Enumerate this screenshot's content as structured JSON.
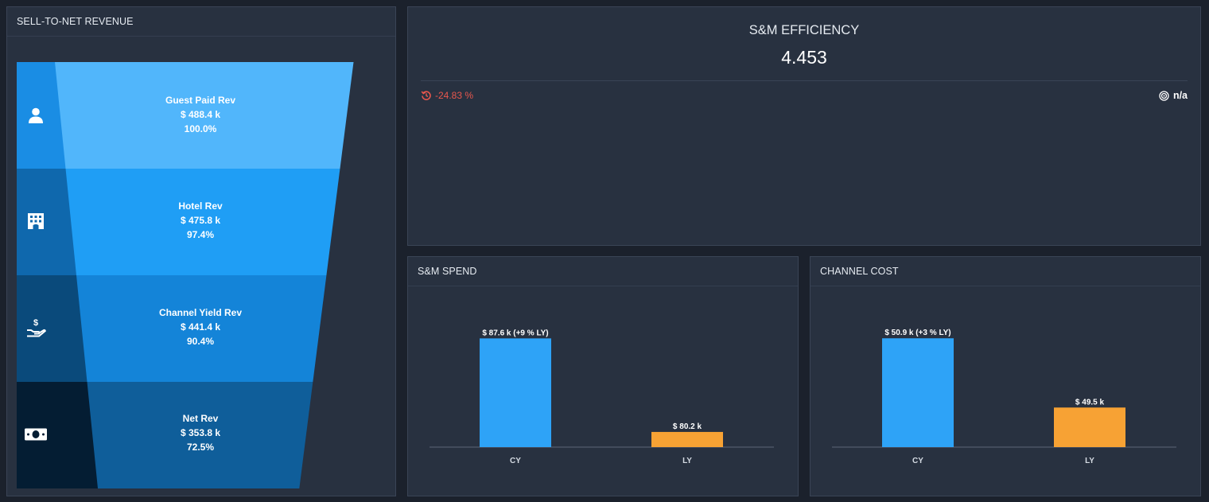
{
  "funnel": {
    "title": "SELL-TO-NET REVENUE",
    "stages": [
      {
        "label": "Guest Paid Rev",
        "value": "$ 488.4 k",
        "pct": "100.0%",
        "ratio": 1.0,
        "icon": "person-icon"
      },
      {
        "label": "Hotel Rev",
        "value": "$ 475.8 k",
        "pct": "97.4%",
        "ratio": 0.974,
        "icon": "hotel-building-icon"
      },
      {
        "label": "Channel Yield Rev",
        "value": "$ 441.4 k",
        "pct": "90.4%",
        "ratio": 0.904,
        "icon": "hand-dollar-icon"
      },
      {
        "label": "Net Rev",
        "value": "$ 353.8 k",
        "pct": "72.5%",
        "ratio": 0.725,
        "icon": "cash-bill-icon"
      }
    ],
    "colors": {
      "bands": [
        "#51b6fb",
        "#1f9ef5",
        "#1484d8",
        "#0f5e9a"
      ],
      "icon_cells": [
        "#1a8de4",
        "#0f68ad",
        "#0a4a7b",
        "#041d33"
      ]
    }
  },
  "kpi": {
    "title": "S&M EFFICIENCY",
    "value": "4.453",
    "change": "-24.83 %",
    "target": "n/a",
    "colors": {
      "change": "#e8574d"
    }
  },
  "spend": {
    "title": "S&M SPEND"
  },
  "cost": {
    "title": "CHANNEL COST"
  },
  "chart_data": [
    {
      "type": "bar",
      "title": "S&M SPEND",
      "categories": [
        "CY",
        "LY"
      ],
      "values": [
        87.6,
        80.2
      ],
      "data_labels": [
        "$ 87.6 k (+9 % LY)",
        "$ 80.2 k"
      ],
      "baseline": 79,
      "ylim": [
        79,
        88
      ],
      "colors": [
        "#2ea3f7",
        "#f7a234"
      ]
    },
    {
      "type": "bar",
      "title": "CHANNEL COST",
      "categories": [
        "CY",
        "LY"
      ],
      "values": [
        50.9,
        49.5
      ],
      "data_labels": [
        "$ 50.9 k (+3 % LY)",
        "$ 49.5 k"
      ],
      "baseline": 48.7,
      "ylim": [
        48.7,
        51.0
      ],
      "colors": [
        "#2ea3f7",
        "#f7a234"
      ]
    }
  ]
}
